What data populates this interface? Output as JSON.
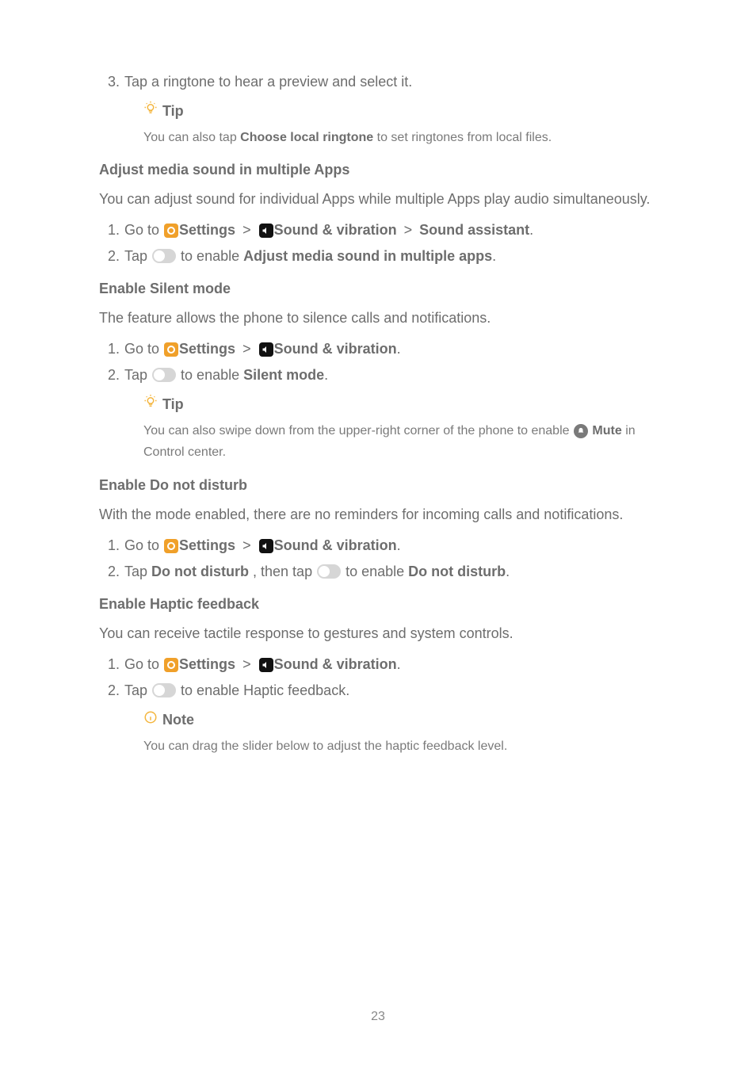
{
  "step3": {
    "num": "3.",
    "text": "Tap a ringtone to hear a preview and select it."
  },
  "tip1": {
    "label": "Tip",
    "body_pre": "You can also tap ",
    "body_bold": "Choose local ringtone",
    "body_post": " to set ringtones from local files."
  },
  "sec_adjust": {
    "heading": "Adjust media sound in multiple Apps",
    "para": "You can adjust sound for individual Apps while multiple Apps play audio simultaneously.",
    "s1_num": "1.",
    "s1_goto": "Go to ",
    "s1_settings": "Settings",
    "s1_sound": "Sound & vibration",
    "s1_assistant": "Sound assistant",
    "s2_num": "2.",
    "s2_tap": "Tap ",
    "s2_enable": " to enable ",
    "s2_bold": "Adjust media sound in multiple apps"
  },
  "sec_silent": {
    "heading": "Enable Silent mode",
    "para": "The feature allows the phone to silence calls and notifications.",
    "s1_num": "1.",
    "s1_goto": "Go to ",
    "s1_settings": "Settings",
    "s1_sound": "Sound & vibration",
    "s2_num": "2.",
    "s2_tap": "Tap ",
    "s2_enable": " to enable ",
    "s2_bold": "Silent mode",
    "tip_label": "Tip",
    "tip_pre": "You can also swipe down from the upper-right corner of the phone to enable ",
    "tip_mute": " Mute",
    "tip_post": " in Control center."
  },
  "sec_dnd": {
    "heading": "Enable Do not disturb",
    "para": "With the mode enabled, there are no reminders for incoming calls and notifications.",
    "s1_num": "1.",
    "s1_goto": "Go to ",
    "s1_settings": "Settings",
    "s1_sound": "Sound & vibration",
    "s2_num": "2.",
    "s2_tap": "Tap ",
    "s2_dnd": "Do not disturb",
    "s2_then": " , then tap ",
    "s2_enable": " to enable ",
    "s2_bold": "Do not disturb"
  },
  "sec_haptic": {
    "heading": "Enable Haptic feedback",
    "para": "You can receive tactile response to gestures and system controls.",
    "s1_num": "1.",
    "s1_goto": "Go to ",
    "s1_settings": "Settings",
    "s1_sound": "Sound & vibration",
    "s2_num": "2.",
    "s2_tap": "Tap ",
    "s2_enable": " to enable Haptic feedback.",
    "note_label": "Note",
    "note_body": "You can drag the slider below to adjust the haptic feedback level."
  },
  "sep": ">",
  "dot": ".",
  "page": "23"
}
